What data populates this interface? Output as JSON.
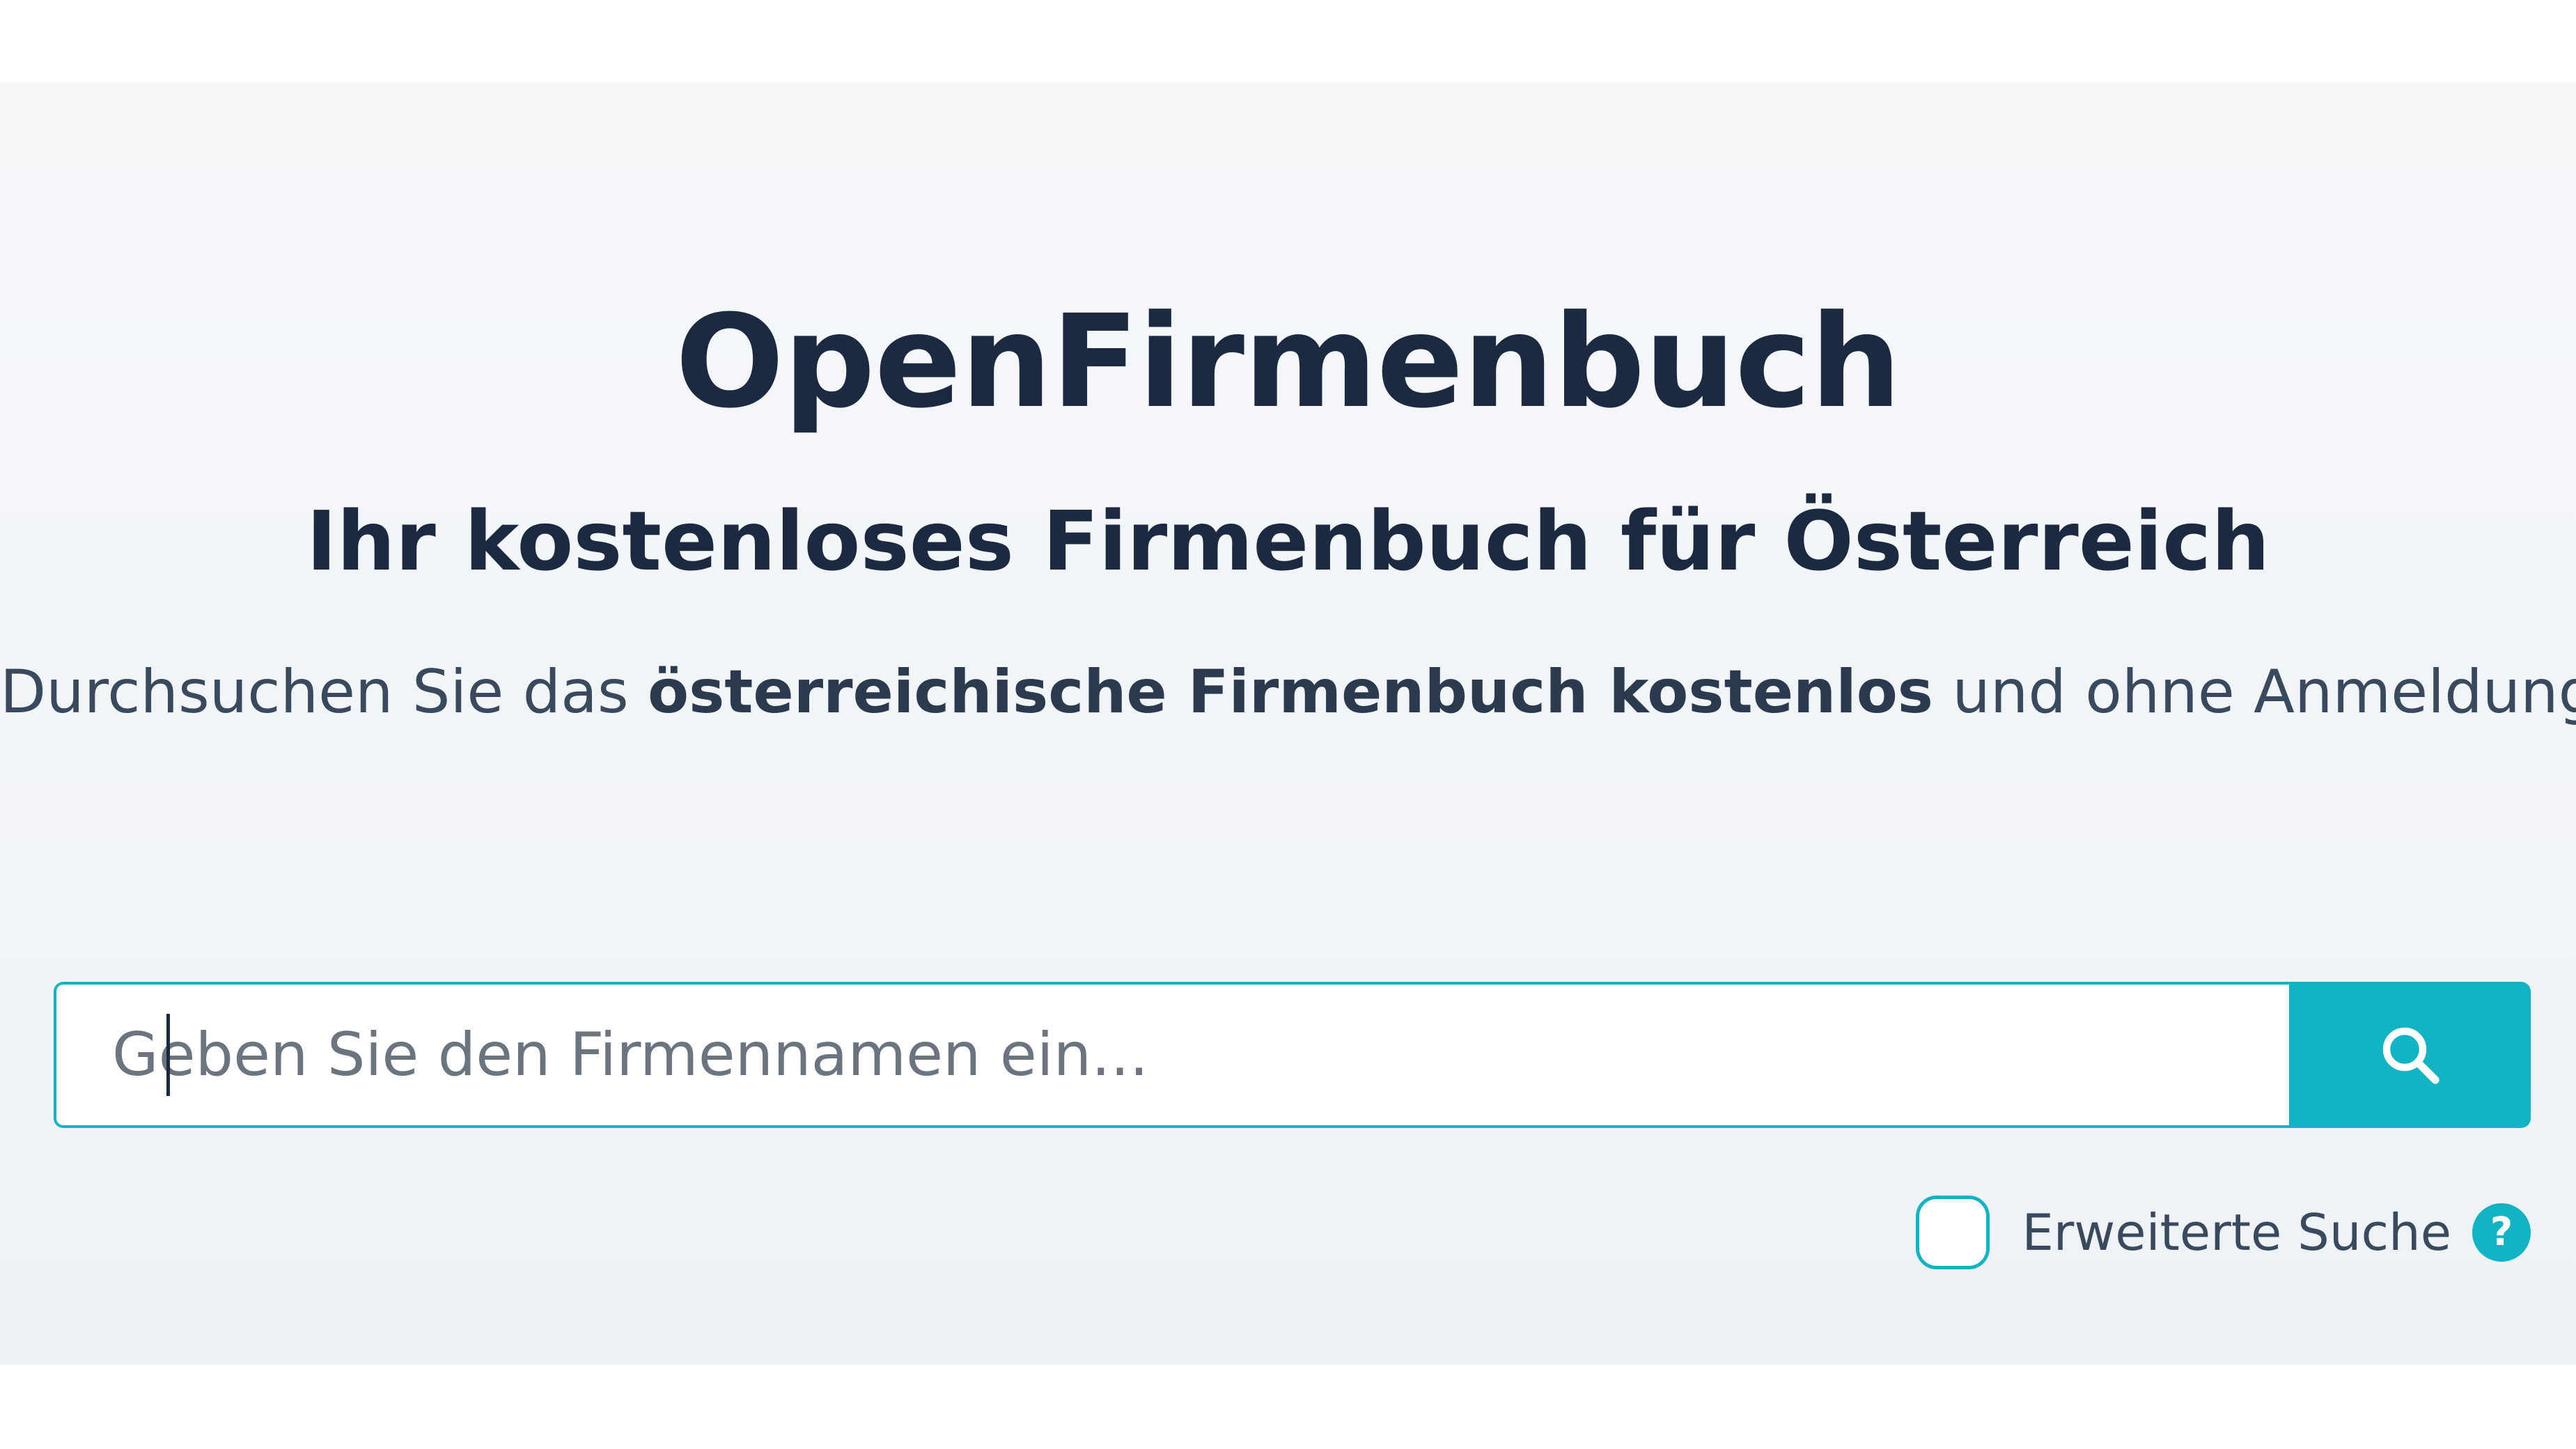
{
  "hero": {
    "title": "OpenFirmenbuch",
    "subtitle": "Ihr kostenloses Firmenbuch für Österreich",
    "description": {
      "prefix": "Durchsuchen Sie das ",
      "bold": "österreichische Firmenbuch kostenlos",
      "suffix": " und ohne Anmeldung."
    }
  },
  "search": {
    "placeholder": "Geben Sie den Firmennamen ein...",
    "value": "",
    "button_icon": "search-icon"
  },
  "advanced_search": {
    "label": "Erweiterte Suche",
    "checked": false,
    "help_icon_text": "?"
  },
  "colors": {
    "accent": "#12b3c3",
    "heading": "#1c2a41",
    "text": "#3a4a5e",
    "background": "#f3f6f9"
  }
}
